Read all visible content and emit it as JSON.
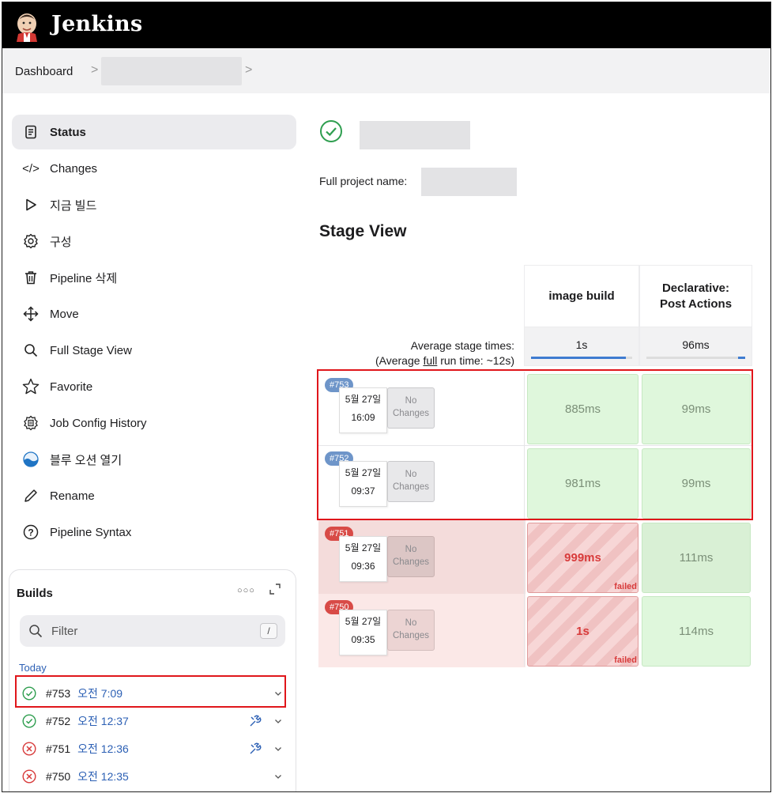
{
  "header": {
    "brand": "Jenkins"
  },
  "breadcrumb": {
    "dashboard": "Dashboard",
    "sep": ">"
  },
  "sidebar": {
    "items": [
      {
        "label": "Status",
        "icon": "document-icon"
      },
      {
        "label": "Changes",
        "icon": "code-icon"
      },
      {
        "label": "지금 빌드",
        "icon": "play-icon"
      },
      {
        "label": "구성",
        "icon": "gear-icon"
      },
      {
        "label": "Pipeline 삭제",
        "icon": "trash-icon"
      },
      {
        "label": "Move",
        "icon": "move-arrows-icon"
      },
      {
        "label": "Full Stage View",
        "icon": "search-icon"
      },
      {
        "label": "Favorite",
        "icon": "star-icon"
      },
      {
        "label": "Job Config History",
        "icon": "config-history-icon"
      },
      {
        "label": "블루 오션 열기",
        "icon": "blue-ocean-icon"
      },
      {
        "label": "Rename",
        "icon": "pencil-icon"
      },
      {
        "label": "Pipeline Syntax",
        "icon": "help-circle-icon"
      }
    ]
  },
  "builds": {
    "title": "Builds",
    "filter_placeholder": "Filter",
    "filter_key": "/",
    "group": "Today",
    "rows": [
      {
        "num": "#753",
        "time": "오전 7:09",
        "status": "success"
      },
      {
        "num": "#752",
        "time": "오전 12:37",
        "status": "success"
      },
      {
        "num": "#751",
        "time": "오전 12:36",
        "status": "failed"
      },
      {
        "num": "#750",
        "time": "오전 12:35",
        "status": "failed"
      }
    ]
  },
  "main": {
    "full_name_label": "Full project name:",
    "stage_view_title": "Stage View"
  },
  "stage_view": {
    "stages": [
      {
        "name": "image build",
        "avg": "1s",
        "avg_fill": 0.94
      },
      {
        "name": "Declarative: Post Actions",
        "avg": "96ms",
        "avg_fill": 0.07
      }
    ],
    "avg_label_line1": "Average stage times:",
    "avg_label_line2_a": "(Average ",
    "avg_label_line2_b": "full",
    "avg_label_line2_c": " run time: ~12s)",
    "runs": [
      {
        "badge": "#753",
        "date": "5월 27일",
        "time": "16:09",
        "changes_1": "No",
        "changes_2": "Changes",
        "status": "success",
        "cells": [
          "885ms",
          "99ms"
        ]
      },
      {
        "badge": "#752",
        "date": "5월 27일",
        "time": "09:37",
        "changes_1": "No",
        "changes_2": "Changes",
        "status": "success",
        "cells": [
          "981ms",
          "99ms"
        ]
      },
      {
        "badge": "#751",
        "date": "5월 27일",
        "time": "09:36",
        "changes_1": "No",
        "changes_2": "Changes",
        "status": "failed",
        "cells": [
          "999ms",
          "111ms"
        ]
      },
      {
        "badge": "#750",
        "date": "5월 27일",
        "time": "09:35",
        "changes_1": "No",
        "changes_2": "Changes",
        "status": "failed",
        "cells": [
          "1s",
          "114ms"
        ]
      }
    ],
    "failed_tag": "failed"
  },
  "colors": {
    "success": "#2e9e4f",
    "failure": "#d83b3b",
    "link": "#2b5fb4",
    "highlight": "#e0161b"
  }
}
